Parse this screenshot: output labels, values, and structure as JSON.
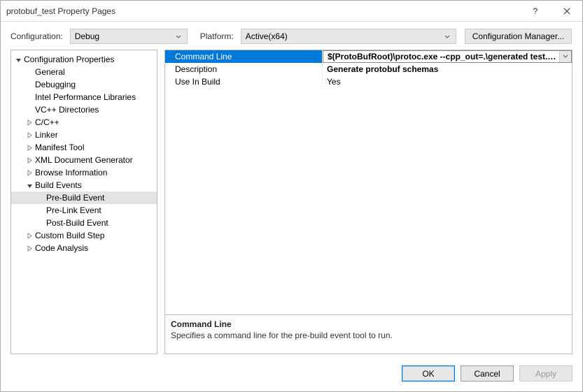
{
  "window": {
    "title": "protobuf_test Property Pages"
  },
  "toolbar": {
    "configuration_label": "Configuration:",
    "configuration_value": "Debug",
    "platform_label": "Platform:",
    "platform_value": "Active(x64)",
    "config_manager_label": "Configuration Manager..."
  },
  "tree": {
    "root": {
      "label": "Configuration Properties",
      "children": [
        {
          "label": "General"
        },
        {
          "label": "Debugging"
        },
        {
          "label": "Intel Performance Libraries"
        },
        {
          "label": "VC++ Directories"
        },
        {
          "label": "C/C++",
          "expandable": true
        },
        {
          "label": "Linker",
          "expandable": true
        },
        {
          "label": "Manifest Tool",
          "expandable": true
        },
        {
          "label": "XML Document Generator",
          "expandable": true
        },
        {
          "label": "Browse Information",
          "expandable": true
        },
        {
          "label": "Build Events",
          "expandable": true,
          "expanded": true,
          "children": [
            {
              "label": "Pre-Build Event",
              "selected": true
            },
            {
              "label": "Pre-Link Event"
            },
            {
              "label": "Post-Build Event"
            }
          ]
        },
        {
          "label": "Custom Build Step",
          "expandable": true
        },
        {
          "label": "Code Analysis",
          "expandable": true
        }
      ]
    }
  },
  "properties": {
    "rows": [
      {
        "name": "Command Line",
        "value": "$(ProtoBufRoot)\\protoc.exe --cpp_out=.\\generated test.proto",
        "selected": true,
        "bold": true
      },
      {
        "name": "Description",
        "value": "Generate protobuf schemas",
        "bold": true
      },
      {
        "name": "Use In Build",
        "value": "Yes"
      }
    ],
    "description": {
      "title": "Command Line",
      "text": "Specifies a command line for the pre-build event tool to run."
    }
  },
  "buttons": {
    "ok": "OK",
    "cancel": "Cancel",
    "apply": "Apply"
  }
}
